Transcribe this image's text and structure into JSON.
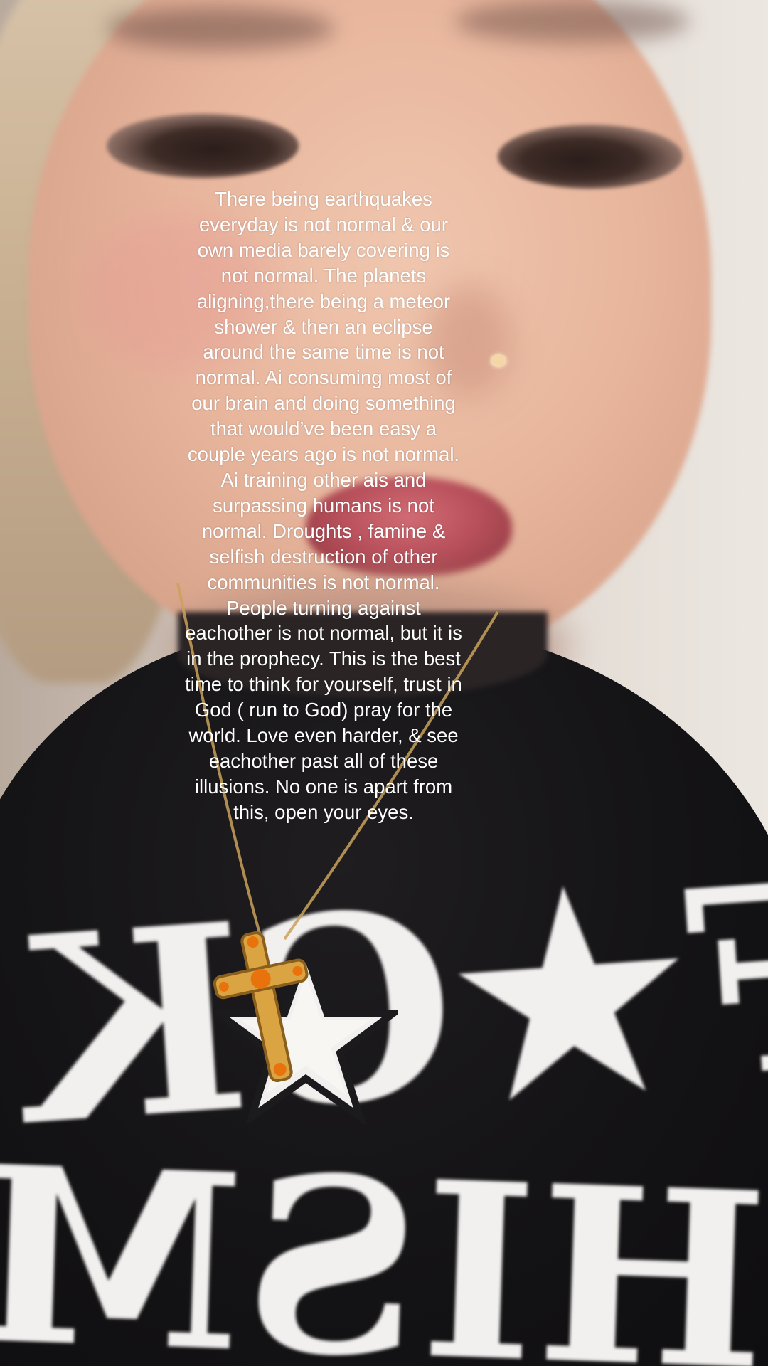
{
  "caption": {
    "text": "There being earthquakes everyday is not normal & our own media barely covering is not normal. The planets aligning,there being a meteor shower & then an eclipse around the same time is not normal. Ai consuming most of our brain and doing something that would’ve been easy a couple years ago is not normal. Ai training other ais and surpassing humans is not normal. Droughts , famine & selfish destruction of other communities is not normal. People turning against eachother is not normal, but it is in the prophecy. This is the best time to think for yourself, trust in God ( run to God) pray for the world. Love even harder, & see eachother past all of these illusions. No one is apart from this, open your eyes."
  },
  "shirt": {
    "word_top": "F★CK",
    "word_bottom": "MACHISM"
  },
  "colors": {
    "caption_text": "#ffffff",
    "shirt": "#141315",
    "shirt_print": "#f1f0ee",
    "pendant_gold": "#d9a441",
    "pendant_stone": "#e8720c"
  },
  "icons": {
    "pendant": "cross-pendant-icon",
    "shirt_star": "star-icon"
  }
}
